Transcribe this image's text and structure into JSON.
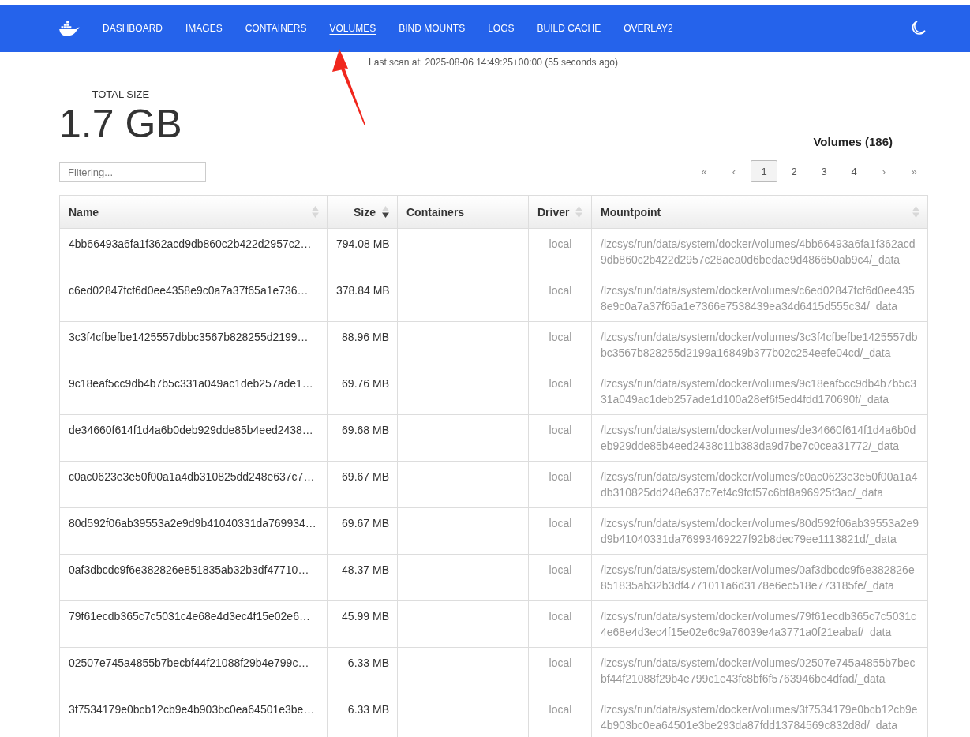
{
  "nav": {
    "items": [
      {
        "label": "DASHBOARD",
        "selected": false
      },
      {
        "label": "IMAGES",
        "selected": false
      },
      {
        "label": "CONTAINERS",
        "selected": false
      },
      {
        "label": "VOLUMES",
        "selected": true
      },
      {
        "label": "BIND MOUNTS",
        "selected": false
      },
      {
        "label": "LOGS",
        "selected": false
      },
      {
        "label": "BUILD CACHE",
        "selected": false
      },
      {
        "label": "OVERLAY2",
        "selected": false
      }
    ]
  },
  "scan_info": "Last scan at: 2025-08-06 14:49:25+00:00 (55 seconds ago)",
  "total_size": {
    "label": "TOTAL SIZE",
    "value": "1.7 GB"
  },
  "filter": {
    "placeholder": "Filtering..."
  },
  "volumes_count": "Volumes (186)",
  "pagination": {
    "first": "«",
    "previous": "‹",
    "pages": [
      {
        "label": "1",
        "selected": true
      },
      {
        "label": "2",
        "selected": false
      },
      {
        "label": "3",
        "selected": false
      },
      {
        "label": "4",
        "selected": false
      }
    ],
    "next": "›",
    "last": "»"
  },
  "table": {
    "columns": [
      {
        "label": "Name",
        "sortable": true,
        "sorted_descending": false
      },
      {
        "label": "Size",
        "sortable": true,
        "sorted_descending": true
      },
      {
        "label": "Containers",
        "sortable": false,
        "sorted_descending": false
      },
      {
        "label": "Driver",
        "sortable": true,
        "sorted_descending": false
      },
      {
        "label": "Mountpoint",
        "sortable": true,
        "sorted_descending": false
      }
    ],
    "rows": [
      {
        "name": "4bb66493a6fa1f362acd9db860c2b422d2957c2…",
        "size": "794.08 MB",
        "driver": "local",
        "mountpoint": "/lzcsys/run/data/system/docker/volumes/4bb66493a6fa1f362acd9db860c2b422d2957c28aea0d6bedae9d486650ab9c4/_data"
      },
      {
        "name": "c6ed02847fcf6d0ee4358e9c0a7a37f65a1e736…",
        "size": "378.84 MB",
        "driver": "local",
        "mountpoint": "/lzcsys/run/data/system/docker/volumes/c6ed02847fcf6d0ee4358e9c0a7a37f65a1e7366e7538439ea34d6415d555c34/_data"
      },
      {
        "name": "3c3f4cfbefbe1425557dbbc3567b828255d2199…",
        "size": "88.96 MB",
        "driver": "local",
        "mountpoint": "/lzcsys/run/data/system/docker/volumes/3c3f4cfbefbe1425557dbbc3567b828255d2199a16849b377b02c254eefe04cd/_data"
      },
      {
        "name": "9c18eaf5cc9db4b7b5c331a049ac1deb257ade1…",
        "size": "69.76 MB",
        "driver": "local",
        "mountpoint": "/lzcsys/run/data/system/docker/volumes/9c18eaf5cc9db4b7b5c331a049ac1deb257ade1d100a28ef6f5ed4fdd170690f/_data"
      },
      {
        "name": "de34660f614f1d4a6b0deb929dde85b4eed2438…",
        "size": "69.68 MB",
        "driver": "local",
        "mountpoint": "/lzcsys/run/data/system/docker/volumes/de34660f614f1d4a6b0deb929dde85b4eed2438c11b383da9d7be7c0cea31772/_data"
      },
      {
        "name": "c0ac0623e3e50f00a1a4db310825dd248e637c7…",
        "size": "69.67 MB",
        "driver": "local",
        "mountpoint": "/lzcsys/run/data/system/docker/volumes/c0ac0623e3e50f00a1a4db310825dd248e637c7ef4c9fcf57c6bf8a96925f3ac/_data"
      },
      {
        "name": "80d592f06ab39553a2e9d9b41040331da769934…",
        "size": "69.67 MB",
        "driver": "local",
        "mountpoint": "/lzcsys/run/data/system/docker/volumes/80d592f06ab39553a2e9d9b41040331da76993469227f92b8dec79ee1113821d/_data"
      },
      {
        "name": "0af3dbcdc9f6e382826e851835ab32b3df47710…",
        "size": "48.37 MB",
        "driver": "local",
        "mountpoint": "/lzcsys/run/data/system/docker/volumes/0af3dbcdc9f6e382826e851835ab32b3df4771011a6d3178e6ec518e773185fe/_data"
      },
      {
        "name": "79f61ecdb365c7c5031c4e68e4d3ec4f15e02e6…",
        "size": "45.99 MB",
        "driver": "local",
        "mountpoint": "/lzcsys/run/data/system/docker/volumes/79f61ecdb365c7c5031c4e68e4d3ec4f15e02e6c9a76039e4a3771a0f21eabaf/_data"
      },
      {
        "name": "02507e745a4855b7becbf44f21088f29b4e799c…",
        "size": "6.33 MB",
        "driver": "local",
        "mountpoint": "/lzcsys/run/data/system/docker/volumes/02507e745a4855b7becbf44f21088f29b4e799c1e43fc8bf6f5763946be4dfad/_data"
      },
      {
        "name": "3f7534179e0bcb12cb9e4b903bc0ea64501e3be…",
        "size": "6.33 MB",
        "driver": "local",
        "mountpoint": "/lzcsys/run/data/system/docker/volumes/3f7534179e0bcb12cb9e4b903bc0ea64501e3be293da87fdd13784569c832d8d/_data"
      }
    ]
  }
}
